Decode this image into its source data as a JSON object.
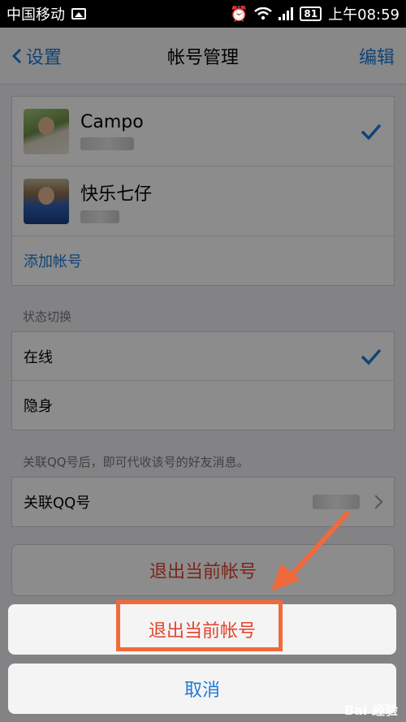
{
  "status_bar": {
    "carrier": "中国移动",
    "battery": "81",
    "time": "上午08:59"
  },
  "nav": {
    "back_label": "设置",
    "title": "帐号管理",
    "edit_label": "编辑"
  },
  "accounts": [
    {
      "name": "Campo",
      "selected": true
    },
    {
      "name": "快乐七仔",
      "selected": false
    }
  ],
  "add_account_label": "添加帐号",
  "status_section": {
    "label": "状态切换",
    "options": [
      {
        "label": "在线",
        "selected": true
      },
      {
        "label": "隐身",
        "selected": false
      }
    ]
  },
  "link_section": {
    "hint": "关联QQ号后，即可代收该号的好友消息。",
    "row_label": "关联QQ号"
  },
  "logout_button_label": "退出当前帐号",
  "action_sheet": {
    "confirm_label": "退出当前帐号",
    "cancel_label": "取消"
  },
  "colors": {
    "accent_blue": "#1e7ad8",
    "destructive_red": "#e0442e",
    "highlight_orange": "#f06a3c"
  },
  "watermark": "Bai 经验"
}
